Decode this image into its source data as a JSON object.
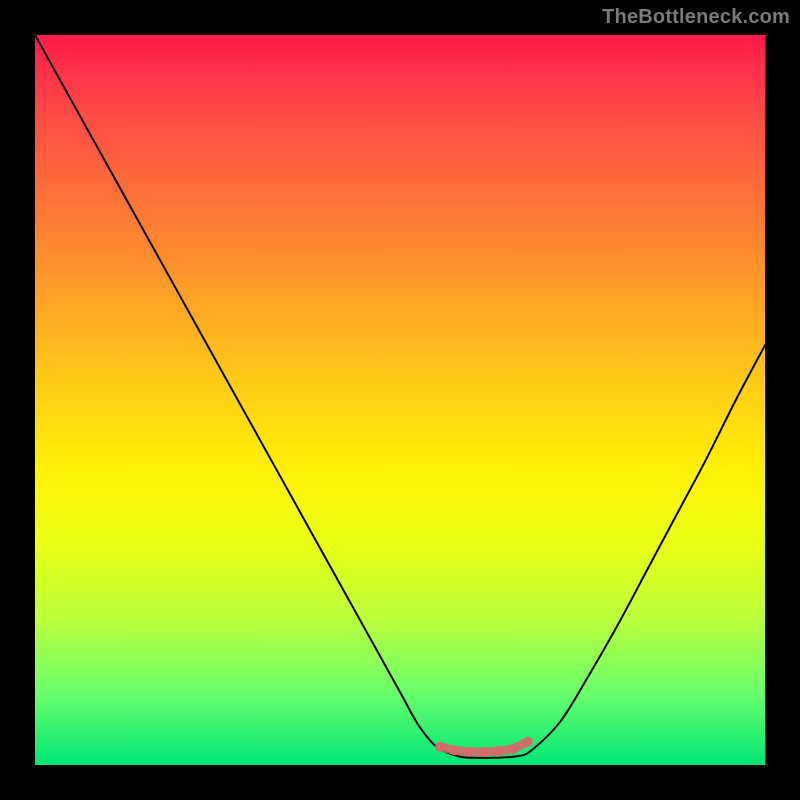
{
  "watermark": "TheBottleneck.com",
  "colors": {
    "gradient_stops": [
      "#ff1a4b",
      "#ff4747",
      "#ff6a3a",
      "#ff8c2e",
      "#ffb020",
      "#ffd313",
      "#fff205",
      "#e8ff14",
      "#baff3a",
      "#6bff6b",
      "#00e676"
    ],
    "curve": "#000000",
    "marker_stroke": "#d46a6a",
    "marker_fill": "#d46a6a"
  },
  "chart_data": {
    "type": "line",
    "title": "",
    "xlabel": "",
    "ylabel": "",
    "xlim": [
      0,
      1
    ],
    "ylim": [
      0,
      1
    ],
    "series": [
      {
        "name": "curve",
        "x": [
          0.0,
          0.05,
          0.1,
          0.15,
          0.2,
          0.25,
          0.3,
          0.35,
          0.4,
          0.45,
          0.5,
          0.525,
          0.55,
          0.58,
          0.6,
          0.63,
          0.66,
          0.68,
          0.72,
          0.76,
          0.8,
          0.84,
          0.88,
          0.92,
          0.96,
          1.0
        ],
        "y": [
          1.0,
          0.91,
          0.82,
          0.73,
          0.64,
          0.55,
          0.46,
          0.37,
          0.28,
          0.19,
          0.1,
          0.055,
          0.025,
          0.012,
          0.01,
          0.01,
          0.012,
          0.02,
          0.06,
          0.125,
          0.195,
          0.27,
          0.345,
          0.42,
          0.5,
          0.575
        ]
      },
      {
        "name": "bottom-plateau-markers",
        "x": [
          0.555,
          0.575,
          0.595,
          0.615,
          0.635,
          0.655,
          0.675
        ],
        "y": [
          0.025,
          0.02,
          0.018,
          0.018,
          0.019,
          0.022,
          0.032
        ]
      }
    ]
  }
}
